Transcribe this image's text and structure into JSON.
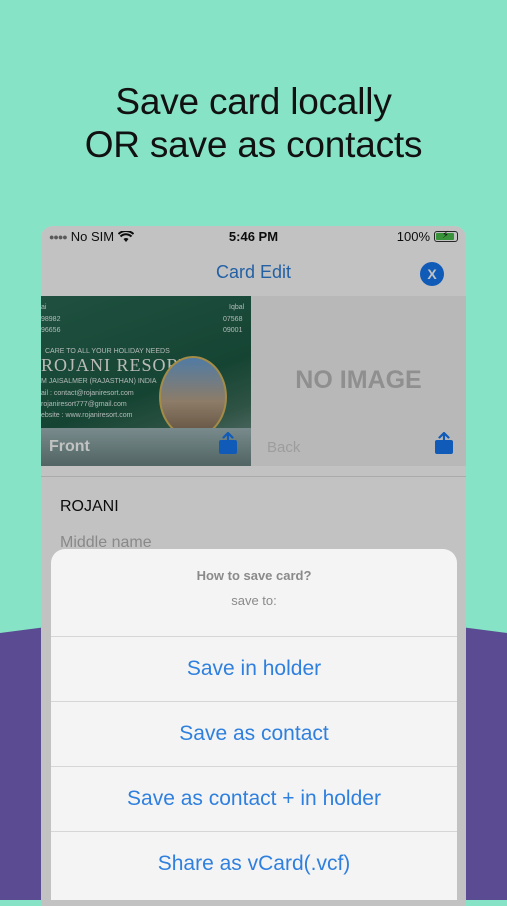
{
  "headline": {
    "line1": "Save card locally",
    "line2": "OR save as contacts"
  },
  "status_bar": {
    "carrier": "No SIM",
    "time": "5:46 PM",
    "battery": "100%"
  },
  "nav": {
    "title": "Card Edit",
    "close_label": "X"
  },
  "card_front": {
    "lines": [
      "ai",
      "98982",
      "96656",
      "Iqbal",
      "07568",
      "09001"
    ],
    "tagline": "CARE TO ALL YOUR HOLIDAY NEEDS",
    "resort_name": "ROJANI RESORT",
    "location": "M JAISALMER (RAJASTHAN) INDIA",
    "email1": "ail : contact@rojaniresort.com",
    "email2": "rojaniresort777@gmail.com",
    "website": "ebsite : www.rojaniresort.com",
    "label": "Front"
  },
  "card_back": {
    "placeholder": "NO IMAGE",
    "label": "Back"
  },
  "form": {
    "first_name": "ROJANI",
    "middle_name_placeholder": "Middle name"
  },
  "sheet": {
    "title": "How to save card?",
    "subtitle": "save to:",
    "options": [
      "Save in holder",
      "Save as contact",
      "Save as contact + in holder",
      "Share as vCard(.vcf)"
    ]
  },
  "colors": {
    "background": "#86e3c6",
    "bottom_band": "#5a4b93",
    "accent": "#2f80de"
  }
}
